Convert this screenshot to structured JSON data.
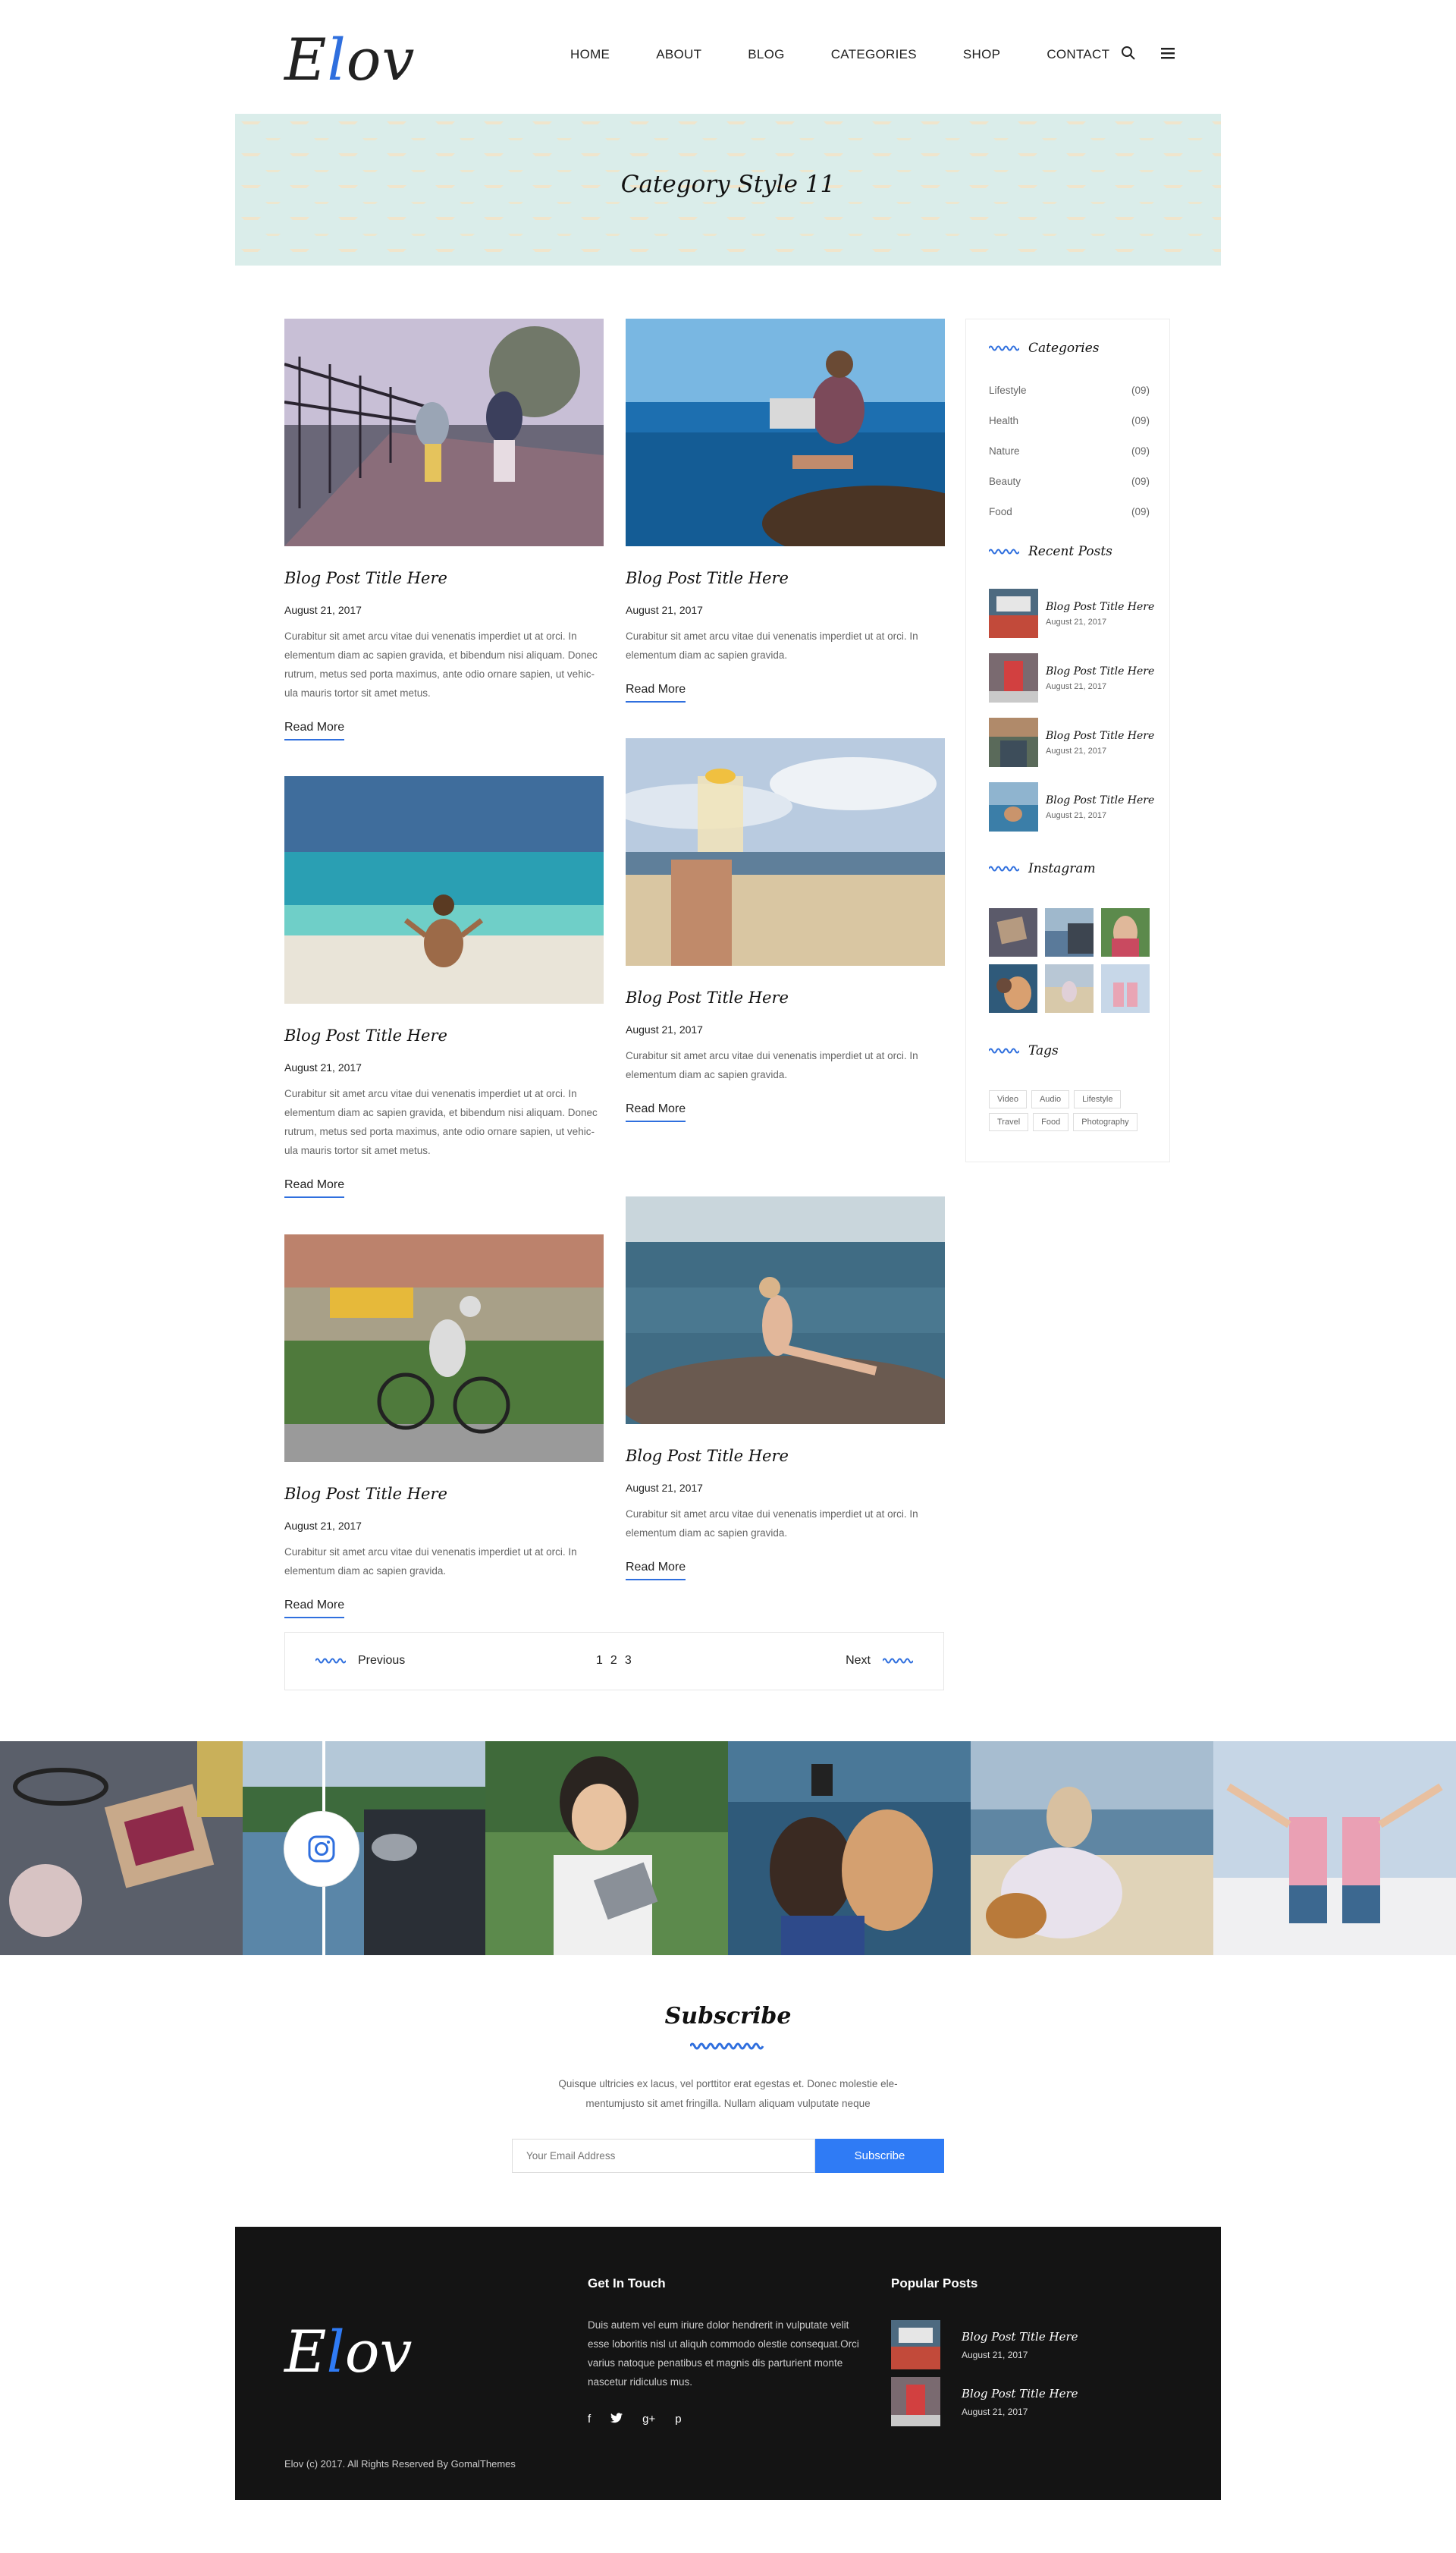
{
  "brand": {
    "logo_pre": "E",
    "logo_accent": "l",
    "logo_post": "ov"
  },
  "nav": {
    "items": [
      "HOME",
      "ABOUT",
      "BLOG",
      "CATEGORIES",
      "SHOP",
      "CONTACT"
    ],
    "icons": [
      "search-icon",
      "menu-icon"
    ]
  },
  "hero": {
    "title": "Category Style 11"
  },
  "posts": [
    {
      "title": "Blog Post Title Here",
      "date": "August 21, 2017",
      "excerpt": "Curabitur sit amet arcu vitae dui venenatis imperdiet ut at orci. In elementum diam ac sapien gravida, et bibendum nisi aliquam. Donec rutrum, metus sed porta maximus, ante odio ornare sapien, ut vehic-ula mauris tortor sit amet metus.",
      "read_more": "Read More"
    },
    {
      "title": "Blog Post Title Here",
      "date": "August 21, 2017",
      "excerpt": "Curabitur sit amet arcu vitae dui venenatis imperdiet ut at orci. In elementum diam ac sapien gravida.",
      "read_more": "Read More"
    },
    {
      "title": "Blog Post Title Here",
      "date": "August 21, 2017",
      "excerpt": "Curabitur sit amet arcu vitae dui venenatis imperdiet ut at orci. In elementum diam ac sapien gravida, et bibendum nisi aliquam. Donec rutrum, metus sed porta maximus, ante odio ornare sapien, ut vehic-ula mauris tortor sit amet metus.",
      "read_more": "Read More"
    },
    {
      "title": "Blog Post Title Here",
      "date": "August 21, 2017",
      "excerpt": "Curabitur sit amet arcu vitae dui venenatis imperdiet ut at orci. In elementum diam ac sapien gravida.",
      "read_more": "Read More"
    },
    {
      "title": "Blog Post Title Here",
      "date": "August 21, 2017",
      "excerpt": "Curabitur sit amet arcu vitae dui venenatis imperdiet ut at orci. In elementum diam ac sapien gravida.",
      "read_more": "Read More"
    },
    {
      "title": "Blog Post Title Here",
      "date": "August 21, 2017",
      "excerpt": "Curabitur sit amet arcu vitae dui venenatis imperdiet ut at orci. In elementum diam ac sapien gravida.",
      "read_more": "Read More"
    }
  ],
  "pagination": {
    "previous": "Previous",
    "next": "Next",
    "pages": [
      "1",
      "2",
      "3"
    ]
  },
  "sidebar": {
    "categories_title": "Categories",
    "categories": [
      {
        "name": "Lifestyle",
        "count": "(09)"
      },
      {
        "name": "Health",
        "count": "(09)"
      },
      {
        "name": "Nature",
        "count": "(09)"
      },
      {
        "name": "Beauty",
        "count": "(09)"
      },
      {
        "name": "Food",
        "count": "(09)"
      }
    ],
    "recent_title": "Recent Posts",
    "recent": [
      {
        "title": "Blog Post Title Here",
        "date": "August 21, 2017"
      },
      {
        "title": "Blog Post Title Here",
        "date": "August 21, 2017"
      },
      {
        "title": "Blog Post Title Here",
        "date": "August 21, 2017"
      },
      {
        "title": "Blog Post Title Here",
        "date": "August 21, 2017"
      }
    ],
    "instagram_title": "Instagram",
    "tags_title": "Tags",
    "tags": [
      "Video",
      "Audio",
      "Lifestyle",
      "Travel",
      "Food",
      "Photography"
    ]
  },
  "subscribe": {
    "title": "Subscribe",
    "text": "Quisque ultricies ex lacus, vel porttitor erat egestas et. Donec molestie ele-mentumjusto sit amet fringilla. Nullam aliquam vulputate neque",
    "placeholder": "Your Email Address",
    "button": "Subscribe"
  },
  "footer": {
    "get_in_touch_title": "Get In Touch",
    "get_in_touch_text": "Duis autem vel eum iriure dolor hendrerit in vulputate velit esse loboritis nisl ut aliquh commodo olestie consequat.Orci varius natoque penatibus et magnis dis parturient monte nascetur ridiculus mus.",
    "social": [
      "f",
      "t",
      "g+",
      "p"
    ],
    "popular_title": "Popular Posts",
    "popular": [
      {
        "title": "Blog Post Title Here",
        "date": "August 21, 2017"
      },
      {
        "title": "Blog Post Title Here",
        "date": "August 21, 2017"
      }
    ],
    "copyright": "Elov (c) 2017. All Rights Reserved By GomalThemes"
  },
  "colors": {
    "accent": "#2f6fde",
    "hero_bg": "#daedea",
    "footer_bg": "#141414",
    "button_bg": "#2f7bf5"
  }
}
